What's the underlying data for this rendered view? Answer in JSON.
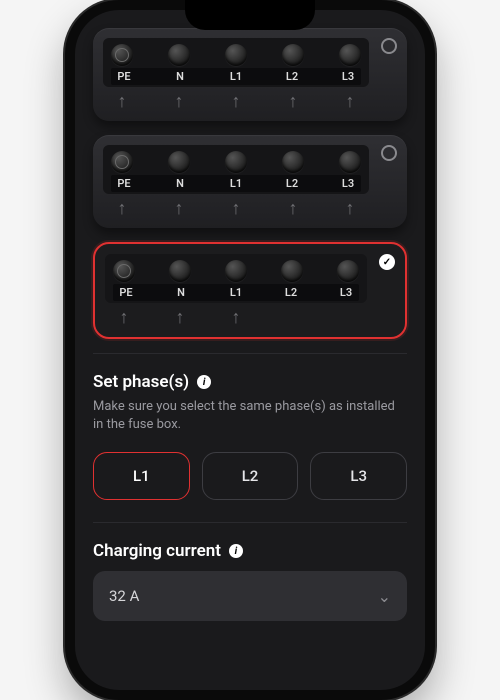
{
  "colors": {
    "accent": "#e03131",
    "bg": "#1a1a1c"
  },
  "terminal_labels": [
    "PE",
    "N",
    "L1",
    "L2",
    "L3"
  ],
  "options": [
    {
      "id": 0,
      "selected": false,
      "arrows": [
        true,
        true,
        true,
        true,
        true
      ]
    },
    {
      "id": 1,
      "selected": false,
      "arrows": [
        true,
        true,
        true,
        true,
        true
      ]
    },
    {
      "id": 2,
      "selected": true,
      "arrows": [
        true,
        true,
        true,
        false,
        false
      ]
    }
  ],
  "set_phase": {
    "title": "Set phase(s)",
    "subtitle": "Make sure you select the same phase(s) as installed in the fuse box.",
    "buttons": [
      {
        "label": "L1",
        "selected": true
      },
      {
        "label": "L2",
        "selected": false
      },
      {
        "label": "L3",
        "selected": false
      }
    ]
  },
  "charging_current": {
    "title": "Charging current",
    "selected": "32 A"
  }
}
